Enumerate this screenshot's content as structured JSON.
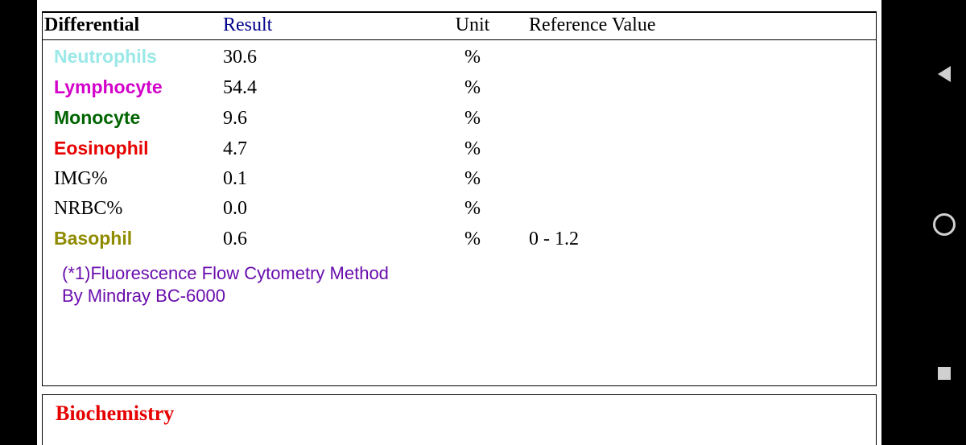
{
  "header": {
    "col1": "Differential",
    "col2": "Result",
    "col3": "Unit",
    "col4": "Reference Value"
  },
  "rows": [
    {
      "label": "Neutrophils",
      "style": "bold c-neutro",
      "result": "30.6",
      "unit": "%",
      "ref": ""
    },
    {
      "label": "Lymphocyte",
      "style": "bold c-lymph",
      "result": "54.4",
      "unit": "%",
      "ref": ""
    },
    {
      "label": "Monocyte",
      "style": "bold c-mono",
      "result": "9.6",
      "unit": "%",
      "ref": ""
    },
    {
      "label": "Eosinophil",
      "style": "bold c-eos",
      "result": "4.7",
      "unit": "%",
      "ref": ""
    },
    {
      "label": "IMG%",
      "style": "",
      "result": "0.1",
      "unit": "%",
      "ref": ""
    },
    {
      "label": "NRBC%",
      "style": "",
      "result": "0.0",
      "unit": "%",
      "ref": ""
    },
    {
      "label": "Basophil",
      "style": "bold c-baso",
      "result": "0.6",
      "unit": "%",
      "ref": "0 - 1.2"
    }
  ],
  "method": {
    "line1": "(*1)Fluorescence Flow Cytometry Method",
    "line2": "By Mindray BC-6000"
  },
  "section2": {
    "title": "Biochemistry"
  }
}
